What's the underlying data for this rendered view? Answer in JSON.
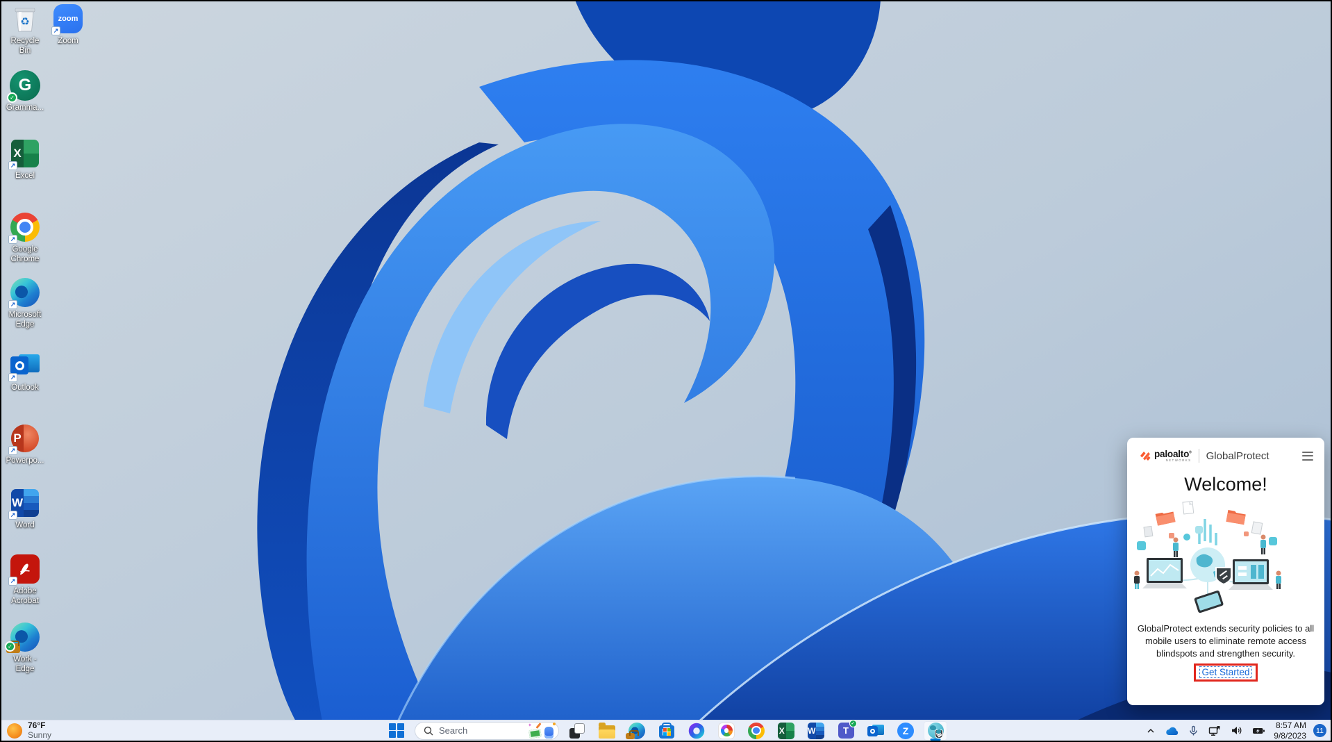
{
  "desktop": {
    "icons": [
      {
        "name": "recycle-bin",
        "label": "Recycle Bin"
      },
      {
        "name": "zoom",
        "label": "Zoom",
        "glyph": "zoom"
      },
      {
        "name": "grammarly",
        "label": "Gramma...",
        "glyph": "G"
      },
      {
        "name": "excel",
        "label": "Excel",
        "glyph": "X"
      },
      {
        "name": "google-chrome",
        "label": "Google Chrome"
      },
      {
        "name": "microsoft-edge",
        "label": "Microsoft Edge"
      },
      {
        "name": "outlook",
        "label": "Outlook"
      },
      {
        "name": "powerpoint",
        "label": "Powerpo...",
        "glyph": "P"
      },
      {
        "name": "word",
        "label": "Word",
        "glyph": "W"
      },
      {
        "name": "adobe-acrobat",
        "label": "Adobe Acrobat"
      },
      {
        "name": "work-edge",
        "label": "Work - Edge"
      }
    ]
  },
  "globalprotect_panel": {
    "brand": "paloalto",
    "registered_mark": "®",
    "brand_sub": "NETWORKS",
    "product": "GlobalProtect",
    "title": "Welcome!",
    "description": "GlobalProtect extends security policies to all mobile users to eliminate remote access blindspots and strengthen security.",
    "cta_label": "Get Started",
    "colors": {
      "brand_orange": "#FA582D",
      "link_blue": "#1668D8",
      "annotation_red": "#E1261D"
    }
  },
  "taskbar": {
    "weather": {
      "temperature": "76°F",
      "condition": "Sunny"
    },
    "search": {
      "placeholder": "Search"
    },
    "pinned_apps": [
      "start",
      "search",
      "task-view",
      "file-explorer",
      "edge-work",
      "microsoft-store",
      "microsoft-365",
      "adobe-creative-cloud",
      "google-chrome",
      "excel",
      "word",
      "teams",
      "outlook",
      "zoom",
      "globalprotect"
    ],
    "active_app": "globalprotect",
    "glyphs": {
      "excel": "X",
      "word": "W",
      "teams": "T",
      "zoom": "Z"
    },
    "tray": {
      "time": "8:57 AM",
      "date": "9/8/2023",
      "notification_count": "11"
    },
    "accent_color": "#0078D4"
  }
}
